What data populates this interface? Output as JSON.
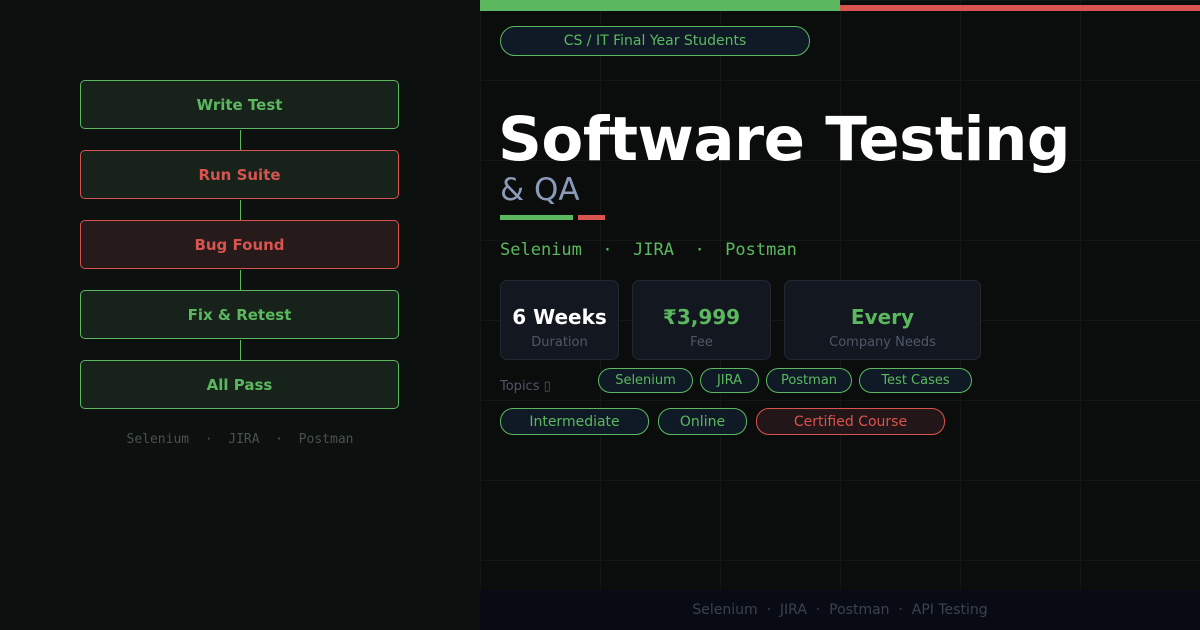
{
  "flow": {
    "steps": [
      "Write Test",
      "Run Suite",
      "Bug Found",
      "Fix & Retest",
      "All Pass"
    ],
    "tools": "Selenium  ·  JIRA  ·  Postman"
  },
  "audience": "CS / IT Final Year Students",
  "title": "Software Testing",
  "subtitle": "& QA",
  "tools_line": "Selenium  ·  JIRA  ·  Postman",
  "stats": [
    {
      "value": "6 Weeks",
      "label": "Duration"
    },
    {
      "value": "₹3,999",
      "label": "Fee"
    },
    {
      "value": "Every",
      "label": "Company Needs"
    }
  ],
  "topics_label": "Topics ▯",
  "topics": [
    "Selenium",
    "JIRA",
    "Postman",
    "Test Cases"
  ],
  "tags": [
    "Intermediate",
    "Online",
    "Certified Course"
  ],
  "footer": "Selenium  ·  JIRA  ·  Postman  ·  API Testing",
  "colors": {
    "accent_green": "#5cb85f",
    "accent_red": "#d9534f",
    "background": "#0c100f",
    "title": "#ffffff",
    "subtitle": "#8a9ab8"
  }
}
